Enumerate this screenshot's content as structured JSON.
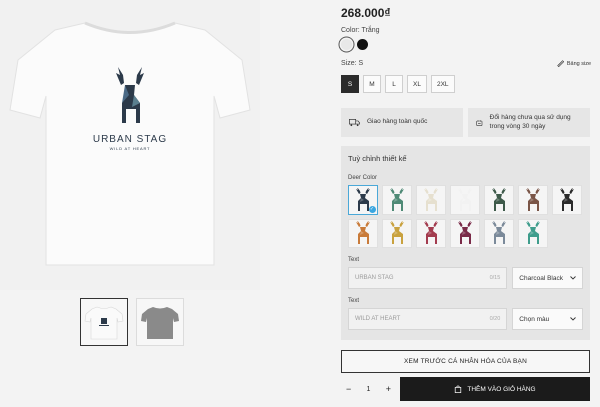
{
  "product": {
    "price": "268.000₫",
    "brand_text": "URBAN STAG",
    "brand_tagline": "WILD AT HEART"
  },
  "color": {
    "label": "Color: Trắng",
    "options": [
      {
        "name": "white",
        "hex": "#e8e8e8",
        "selected": true
      },
      {
        "name": "black",
        "hex": "#111111",
        "selected": false
      }
    ]
  },
  "size": {
    "label": "Size: S",
    "guide_label": "Bảng size",
    "options": [
      "S",
      "M",
      "L",
      "XL",
      "2XL"
    ],
    "selected": "S"
  },
  "benefits": [
    {
      "icon": "truck-icon",
      "text": "Giao hàng toàn quốc"
    },
    {
      "icon": "return-icon",
      "text": "Đổi hàng chưa qua sử dụng trong vòng 30 ngày"
    }
  ],
  "customize": {
    "title": "Tuỳ chỉnh thiết kế",
    "deer_color_label": "Deer Color",
    "deer_colors": [
      "#2c3a4a",
      "#4f8a76",
      "#e6e0cf",
      "#f2f2f2",
      "#3e5a4a",
      "#7a5547",
      "#2b2b2b",
      "#c97b3a",
      "#c9a23f",
      "#a33c4f",
      "#7a2a48",
      "#7b8a9a",
      "#3f9d8c"
    ],
    "selected_index": 0,
    "text1": {
      "label": "Text",
      "placeholder": "URBAN STAG",
      "count": "0/15",
      "color_value": "Charcoal Black"
    },
    "text2": {
      "label": "Text",
      "placeholder": "WILD AT HEART",
      "count": "0/20",
      "color_value": "Chọn màu"
    }
  },
  "actions": {
    "preview_label": "XEM TRƯỚC CÁ NHÂN HÓA CỦA BẠN",
    "quantity": "1",
    "minus": "−",
    "plus": "+",
    "add_to_cart_label": "THÊM VÀO GIỎ HÀNG"
  }
}
